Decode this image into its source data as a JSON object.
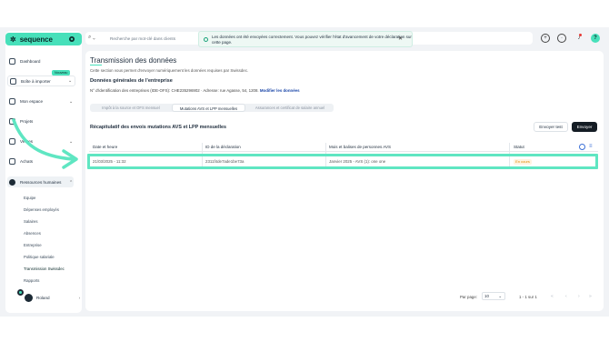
{
  "app": {
    "logo_text": "sequence"
  },
  "sidebar": {
    "new_badge": "Nouveau",
    "items": [
      {
        "label": "Dashboard"
      },
      {
        "label": "Boîte à importer"
      },
      {
        "label": "Mon espace"
      },
      {
        "label": "Projets"
      },
      {
        "label": "Ventes"
      },
      {
        "label": "Achats"
      },
      {
        "label": "Ressources humaines"
      }
    ],
    "sub_items": [
      {
        "label": "Equipe"
      },
      {
        "label": "Dépenses employés"
      },
      {
        "label": "Salaires"
      },
      {
        "label": "Absences"
      },
      {
        "label": "Entreprise"
      },
      {
        "label": "Politique salariale"
      },
      {
        "label": "Transmission Swissdec"
      },
      {
        "label": "Rapports"
      }
    ],
    "user_name": "Roland"
  },
  "topbar": {
    "search_placeholder": "Recherche par mot-clé dans clients"
  },
  "toast": {
    "message": "Les données ont été envoyées correctement. Vous pouvez vérifier l'état d'avancement de votre déclaration sur cette page."
  },
  "page": {
    "title": "Transmission des données",
    "description": "Cette section vous permet d'envoyer numériquement les données requises par Swissdec.",
    "general_heading": "Données générales de l'entreprise",
    "ide_text": "N° d'identification des entreprises (IDE-OFS): CHE235296902 · Adresse: rue Agasse, 54, 1208.",
    "ide_link": "Modifier les données",
    "tabs": [
      {
        "label": "Impôt à la source et OFS mensuel"
      },
      {
        "label": "Mutations AVS et LPP mensuelles"
      },
      {
        "label": "Assurances et certificat de salaire annuel"
      }
    ],
    "summary_heading": "Récapitulatif des envois mutations AVS et LPP mensuelles",
    "btn_test": "Envoyer test",
    "btn_send": "Envoyer",
    "table": {
      "headers": [
        "Date et heure",
        "ID de la déclaration",
        "Mois et balises de personnes AVS",
        "Statut"
      ],
      "rows": [
        {
          "date": "21/03/2025 - 11:32",
          "id": "2311f4de7ade1be73a",
          "month": "Janvier 2025 - AVS (1): one one",
          "status": "En cours"
        }
      ]
    },
    "footer": {
      "per_page_label": "Par page:",
      "per_page_value": "10",
      "range": "1 - 1 sur 1"
    }
  },
  "colors": {
    "accent": "#47e0ba",
    "highlight": "#5fe6c2",
    "dark": "#141c24",
    "status": "#e08a00"
  }
}
